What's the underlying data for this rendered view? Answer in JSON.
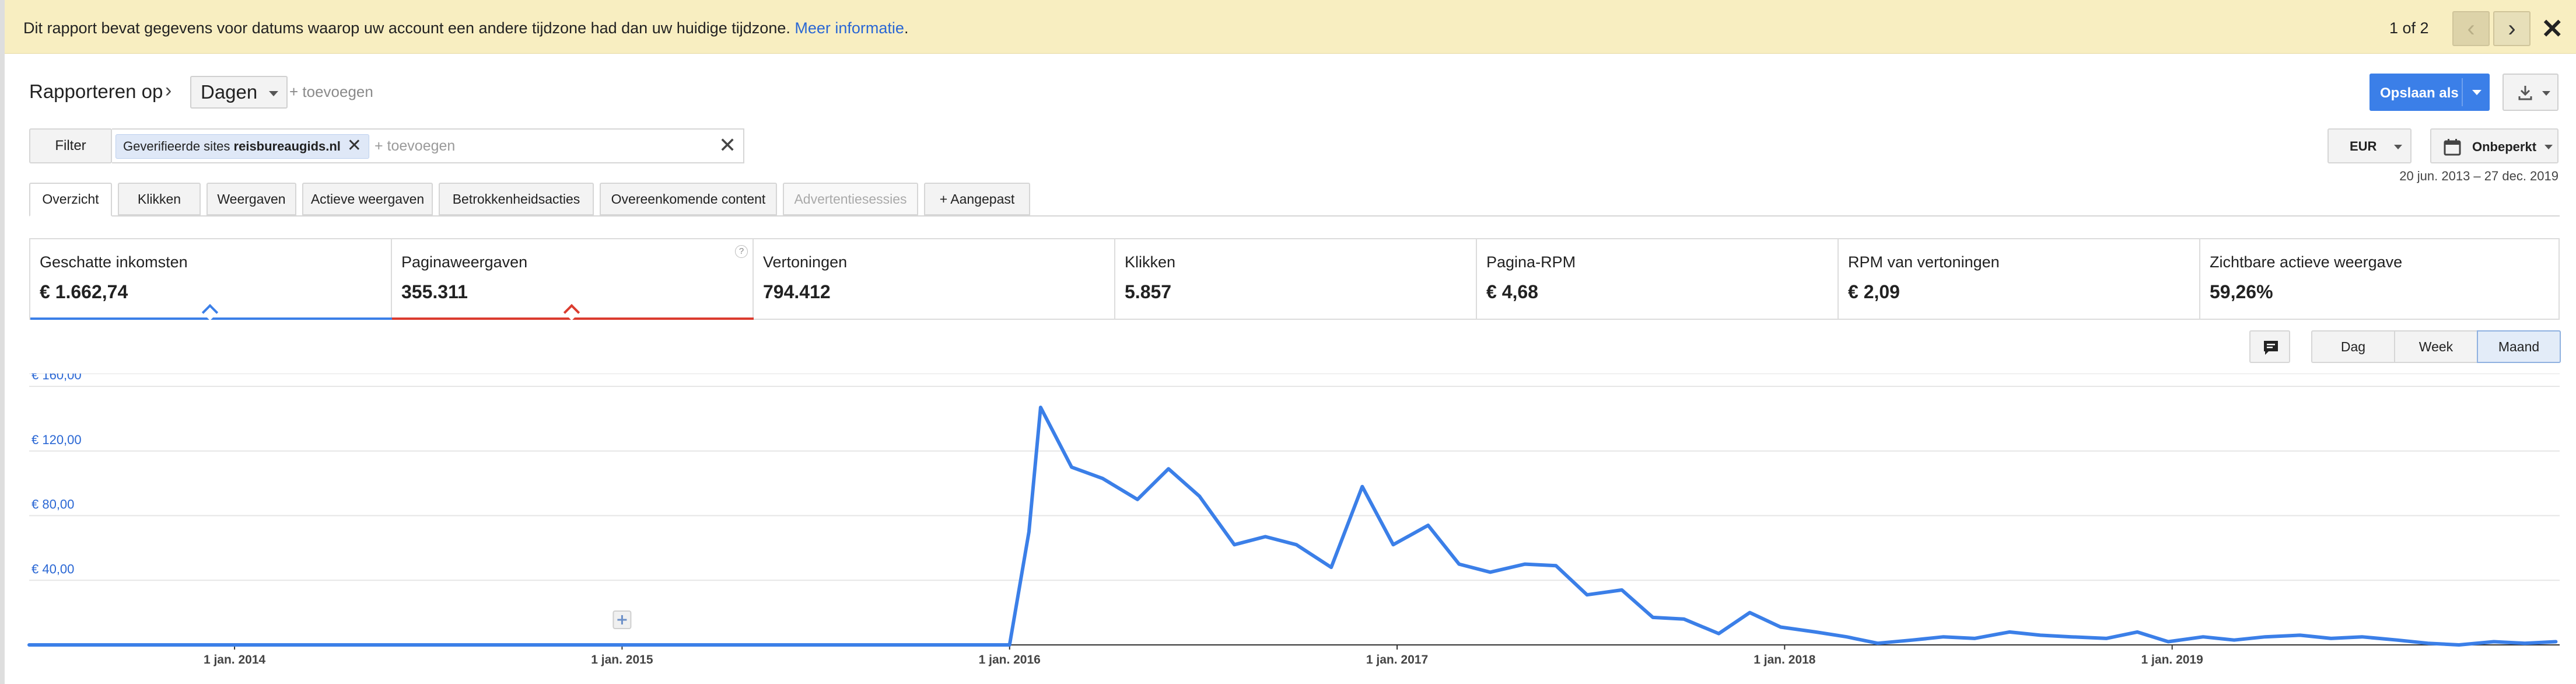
{
  "banner": {
    "message": "Dit rapport bevat gegevens voor datums waarop uw account een andere tijdzone had dan uw huidige tijdzone. ",
    "link": "Meer informatie",
    "link_suffix": ".",
    "pager": "1 of 2",
    "prev_glyph": "‹",
    "next_glyph": "›",
    "close_glyph": "✕"
  },
  "header": {
    "report_on": "Rapporteren op",
    "chevron": "›",
    "dimension": "Dagen",
    "add_dimension": "+ toevoegen",
    "save_label": "Opslaan als"
  },
  "filter": {
    "button": "Filter",
    "chip_prefix": "Geverifieerde sites ",
    "chip_value": "reisbureaugids.nl",
    "chip_close": "✕",
    "add": "+ toevoegen",
    "clear": "✕",
    "currency": "EUR",
    "date_preset": "Onbeperkt",
    "date_range": "20 jun. 2013 – 27 dec. 2019"
  },
  "tabs": [
    {
      "label": "Overzicht",
      "active": true
    },
    {
      "label": "Klikken"
    },
    {
      "label": "Weergaven"
    },
    {
      "label": "Actieve weergaven"
    },
    {
      "label": "Betrokkenheidsacties"
    },
    {
      "label": "Overeenkomende content"
    },
    {
      "label": "Advertentiesessies",
      "disabled": true
    },
    {
      "label": "+  Aangepast"
    }
  ],
  "metrics": [
    {
      "name": "Geschatte inkomsten",
      "value": "€ 1.662,74",
      "color": "#3b7fe8"
    },
    {
      "name": "Paginaweergaven",
      "value": "355.311",
      "color": "#db3b2e"
    },
    {
      "name": "Vertoningen",
      "value": "794.412"
    },
    {
      "name": "Klikken",
      "value": "5.857"
    },
    {
      "name": "Pagina-RPM",
      "value": "€ 4,68"
    },
    {
      "name": "RPM van vertoningen",
      "value": "€ 2,09"
    },
    {
      "name": "Zichtbare actieve weergave",
      "value": "59,26%"
    }
  ],
  "help_glyph": "?",
  "granularity": {
    "day": "Dag",
    "week": "Week",
    "month": "Maand",
    "selected": "Maand"
  },
  "colors": {
    "line": "#3b7fe8",
    "axis_label": "#2a67d4"
  },
  "chart_data": {
    "type": "line",
    "ylim": [
      0,
      160
    ],
    "y_ticks": [
      {
        "value": 40,
        "label": "€ 40,00"
      },
      {
        "value": 80,
        "label": "€ 80,00"
      },
      {
        "value": 120,
        "label": "€ 120,00"
      },
      {
        "value": 160,
        "label": "€ 160,00"
      }
    ],
    "x_ticks": [
      {
        "value": 2014.0,
        "label": "1 jan. 2014"
      },
      {
        "value": 2015.0,
        "label": "1 jan. 2015"
      },
      {
        "value": 2016.0,
        "label": "1 jan. 2016"
      },
      {
        "value": 2017.0,
        "label": "1 jan. 2017"
      },
      {
        "value": 2018.0,
        "label": "1 jan. 2018"
      },
      {
        "value": 2019.0,
        "label": "1 jan. 2019"
      }
    ],
    "xlim": [
      2013.47,
      2020.0
    ],
    "annotation_x": 2015.0,
    "series": [
      {
        "x": [
          2013.47,
          2013.6,
          2014.0,
          2014.5,
          2015.0,
          2015.5,
          2016.0,
          2016.05,
          2016.08,
          2016.16,
          2016.24,
          2016.33,
          2016.41,
          2016.49,
          2016.58,
          2016.66,
          2016.74,
          2016.83,
          2016.91,
          2016.99,
          2017.08,
          2017.16,
          2017.24,
          2017.33,
          2017.41,
          2017.49,
          2017.58,
          2017.66,
          2017.74,
          2017.83,
          2017.91,
          2017.99,
          2018.08,
          2018.16,
          2018.24,
          2018.33,
          2018.41,
          2018.49,
          2018.58,
          2018.66,
          2018.74,
          2018.83,
          2018.91,
          2018.99,
          2019.08,
          2019.16,
          2019.24,
          2019.33,
          2019.41,
          2019.49,
          2019.58,
          2019.66,
          2019.74,
          2019.83,
          2019.91,
          2019.99
        ],
        "y": [
          0,
          0,
          0,
          0,
          0,
          0,
          0,
          70,
          147,
          110,
          103,
          90,
          109,
          92,
          62,
          67,
          62,
          48,
          98,
          62,
          74,
          50,
          45,
          50,
          49,
          31,
          34,
          17,
          16,
          7,
          20,
          11,
          8,
          5,
          1,
          3,
          5,
          4,
          8,
          6,
          5,
          4,
          8,
          2,
          5,
          3,
          5,
          6,
          4,
          5,
          3,
          1,
          0,
          2,
          1,
          2
        ]
      }
    ]
  }
}
